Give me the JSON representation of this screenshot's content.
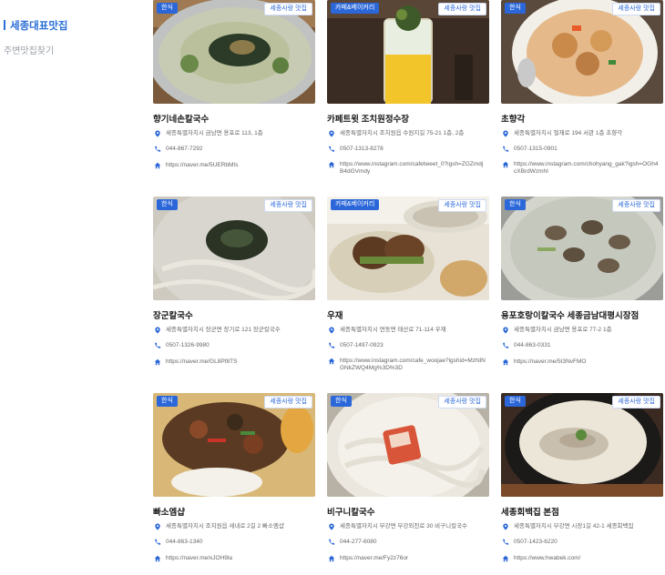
{
  "sidebar": {
    "active_label": "세종대표맛집",
    "inactive_label": "주변맛집찾기"
  },
  "colors": {
    "accent": "#2b67d9"
  },
  "icons": {
    "address": "location-pin-icon",
    "phone": "phone-icon",
    "link": "home-icon"
  },
  "restaurants": [
    {
      "name": "향기네손칼국수",
      "category": "한식",
      "badge": "세종사랑 맛집",
      "address": "세종특별자치시 금남면 용포로 113, 1층",
      "phone": "044-867-7292",
      "link": "https://naver.me/5UERbMIs"
    },
    {
      "name": "카페트윗 조치원정수장",
      "category": "카페&베이커리",
      "badge": "세종사랑 맛집",
      "address": "세종특별자치시 조치원읍 수원지길 75-21 1층, 2층",
      "phone": "0507-1313-8278",
      "link": "https://www.instagram.com/cafetweet_0?igsh=ZGZmdjB4dGVmdy"
    },
    {
      "name": "초향각",
      "category": "한식",
      "badge": "세종사랑 맛집",
      "address": "세종특별자치시 절재로 194 서관 1층 초향각",
      "phone": "0507-1315-0901",
      "link": "https://www.instagram.com/chohyang_gak?igsh=OGh4cXBrdWzmhI"
    },
    {
      "name": "장군칼국수",
      "category": "한식",
      "badge": "세종사랑 맛집",
      "address": "세종특별자치시 장군면 장기로 121 장군칼국수",
      "phone": "0507-1326-9980",
      "link": "https://naver.me/GL8Pf8TS"
    },
    {
      "name": "우재",
      "category": "카페&베이커리",
      "badge": "세종사랑 맛집",
      "address": "세종특별자치시 연동면 태산로 71-114 우재",
      "phone": "0507-1497-0923",
      "link": "https://www.instagram.com/cafe_woojae?igshid=MzNlNGNkZWQ4Mg%3D%3D"
    },
    {
      "name": "용포호랑이칼국수 세종금남대평시장점",
      "category": "한식",
      "badge": "세종사랑 맛집",
      "address": "세종특별자치시 금남면 용포로 77-2 1층",
      "phone": "044-863-0331",
      "link": "https://naver.me/5t3NvFMO"
    },
    {
      "name": "빠소엠샵",
      "category": "한식",
      "badge": "세종사랑 맛집",
      "address": "세종특별자치시 조치원읍 새내로 2길 2 빠소엠샵",
      "phone": "044-863-1340",
      "link": "https://naver.me/xJOH9la"
    },
    {
      "name": "비구니칼국수",
      "category": "한식",
      "badge": "세종사랑 맛집",
      "address": "세종특별자치시 부강면 부강외천로 30 비구니칼국수",
      "phone": "044-277-6080",
      "link": "https://naver.me/Fy2z76or"
    },
    {
      "name": "세종회백집 본점",
      "category": "한식",
      "badge": "세종사랑 맛집",
      "address": "세종특별자치시 부강면 시장1길 42-1 세종회백집",
      "phone": "0507-1423-6220",
      "link": "https://www.hwabek.com/"
    }
  ]
}
